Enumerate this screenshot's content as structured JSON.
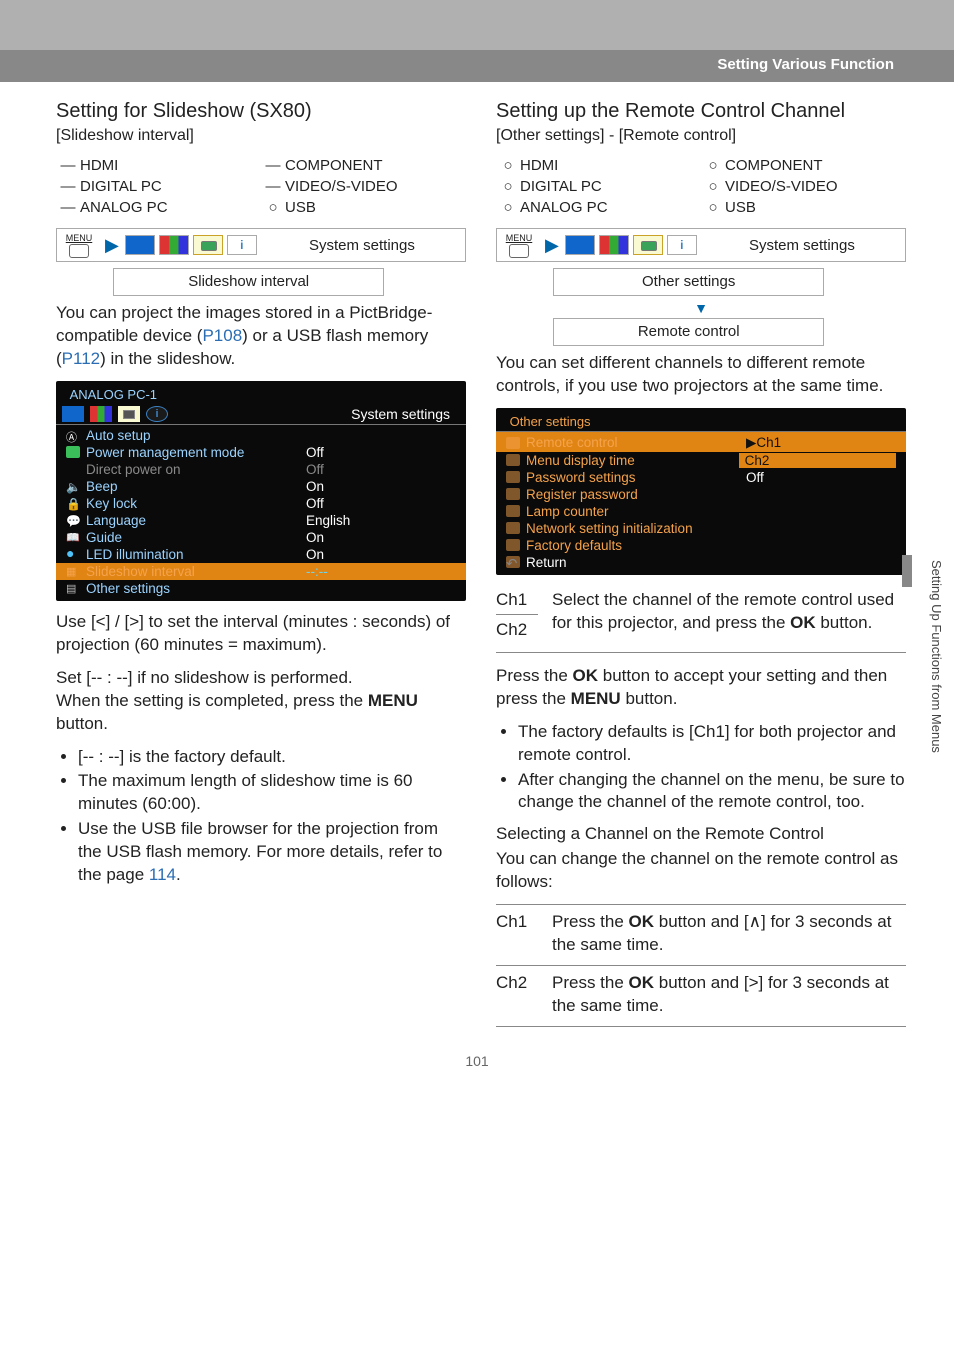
{
  "header": {
    "title": "Setting Various Function"
  },
  "side_label": "Setting Up Functions from Menus",
  "page_number": "101",
  "inputs": {
    "hdmi": "HDMI",
    "digital_pc": "DIGITAL PC",
    "analog_pc": "ANALOG PC",
    "component": "COMPONENT",
    "video_svideo": "VIDEO/S-VIDEO",
    "usb": "USB"
  },
  "nav": {
    "menu_label": "MENU",
    "system_settings": "System settings"
  },
  "left": {
    "title": "Setting for Slideshow (SX80)",
    "subtitle": "[Slideshow interval]",
    "breadcrumb_box": "Slideshow interval",
    "body1_a": "You can project the images stored in a PictBridge-compatible device (",
    "body1_link1": "P108",
    "body1_b": ") or a USB flash memory (",
    "body1_link2": "P112",
    "body1_c": ") in the slide­show.",
    "osd": {
      "header": "ANALOG PC-1",
      "tab_label": "System settings",
      "rows": [
        {
          "icon": "A",
          "l": "Auto setup",
          "r": ""
        },
        {
          "icon": "green",
          "l": "Power management mode",
          "r": "Off"
        },
        {
          "icon": "dim",
          "l": "Direct power on",
          "r": "Off",
          "dim": true
        },
        {
          "icon": "speaker",
          "l": "Beep",
          "r": "On"
        },
        {
          "icon": "lock",
          "l": "Key lock",
          "r": "Off"
        },
        {
          "icon": "lang",
          "l": "Language",
          "r": "English"
        },
        {
          "icon": "guide",
          "l": "Guide",
          "r": "On"
        },
        {
          "icon": "led",
          "l": "LED illumination",
          "r": "On"
        },
        {
          "icon": "slide",
          "l": "Slideshow interval",
          "r": "--:--",
          "hi": true
        },
        {
          "icon": "other",
          "l": "Other settings",
          "r": ""
        }
      ]
    },
    "body2": "Use [<] / [>] to set the interval (minutes : seconds) of projection (60 minutes = max­imum).",
    "body3": "Set [-- : --] if no slideshow is performed.",
    "body4_a": "When the setting is completed, press the ",
    "body4_b": "MENU",
    "body4_c": " button.",
    "bullets": [
      "[-- : --] is the factory default.",
      "The maximum length of slideshow time is 60 minutes (60:00)."
    ],
    "bullet3_a": "Use the USB file browser for the projec­tion from the USB flash memory. For more details, refer to the page ",
    "bullet3_link": "114",
    "bullet3_b": "."
  },
  "right": {
    "title": "Setting up the Remote Control Channel",
    "subtitle": "[Other settings] - [Remote control]",
    "breadcrumb_box1": "Other settings",
    "breadcrumb_box2": "Remote control",
    "body1": "You can set different channels to different remote controls, if you use two projectors at the same time.",
    "osd": {
      "header": "Other settings",
      "rows": [
        {
          "l": "Remote control",
          "r": "▶Ch1",
          "hi": true
        },
        {
          "l": "Menu display time",
          "r": "Ch2",
          "hi_r": true
        },
        {
          "l": "Password settings",
          "r": "Off"
        },
        {
          "l": "Register password",
          "r": ""
        },
        {
          "l": "Lamp counter",
          "r": ""
        },
        {
          "l": "Network setting initialization",
          "r": ""
        },
        {
          "l": "Factory defaults",
          "r": ""
        },
        {
          "l": "Return",
          "r": ""
        }
      ]
    },
    "ch_labels": {
      "ch1": "Ch1",
      "ch2": "Ch2"
    },
    "ch_desc_a": "Select the channel of the remote control used for this projector, and press the ",
    "ch_desc_b": "OK",
    "ch_desc_c": " button.",
    "body2_a": "Press the ",
    "body2_b": "OK",
    "body2_c": " button to accept your setting and then press the ",
    "body2_d": "MENU",
    "body2_e": " button.",
    "bullets": [
      "The factory defaults is [Ch1] for both projector and remote control.",
      "After changing the channel on the menu, be sure to change the channel of the remote control, too."
    ],
    "sub2": "Selecting a Channel on the Remote Con­trol",
    "body3": "You can change the channel on the remote control as follows:",
    "tbl": {
      "r1_l": "Ch1",
      "r1_a": "Press the ",
      "r1_b": "OK",
      "r1_c": " button and [∧] for 3 sec­onds at the same time.",
      "r2_l": "Ch2",
      "r2_a": "Press the ",
      "r2_b": "OK",
      "r2_c": " button and [>] for 3 sec­onds at the same time."
    }
  }
}
